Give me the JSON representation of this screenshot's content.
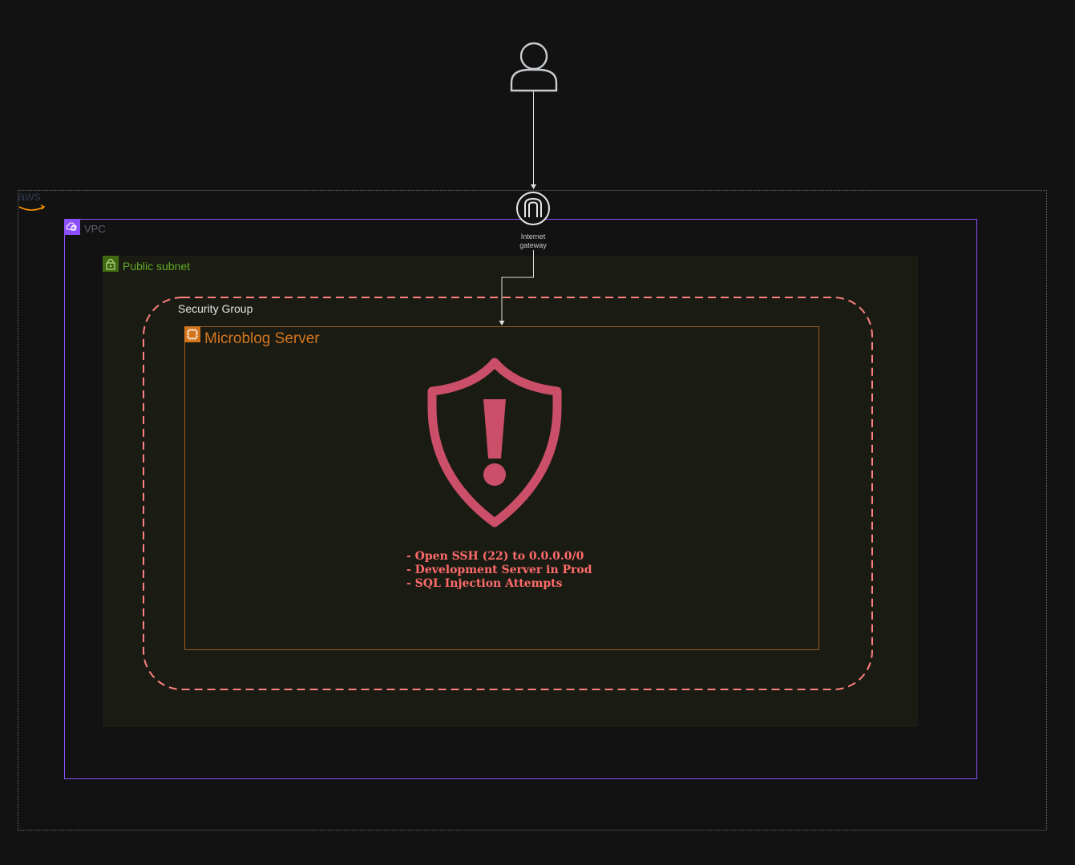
{
  "diagram": {
    "aws_logo": "aws",
    "vpc": {
      "label": "VPC",
      "icon": "vpc-cloud-icon",
      "color": "#8c4fff"
    },
    "subnet": {
      "label": "Public subnet",
      "icon": "padlock-icon",
      "color": "#62a924"
    },
    "security_group": {
      "label": "Security Group",
      "border_color": "#ff8080"
    },
    "server": {
      "label": "Microblog Server",
      "icon": "chip-icon",
      "color": "#d4751d"
    },
    "internet_gateway": {
      "label_line1": "Internet",
      "label_line2": "gateway",
      "icon": "internet-gateway-icon"
    },
    "user": {
      "icon": "user-icon"
    },
    "alert": {
      "icon": "shield-alert-icon",
      "color": "#cc4f6a",
      "findings": [
        "- Open SSH (22) to 0.0.0.0/0",
        "- Development Server in Prod",
        "- SQL Injection Attempts"
      ]
    },
    "edges": [
      {
        "from": "user",
        "to": "internet_gateway"
      },
      {
        "from": "internet_gateway",
        "to": "server"
      }
    ]
  }
}
